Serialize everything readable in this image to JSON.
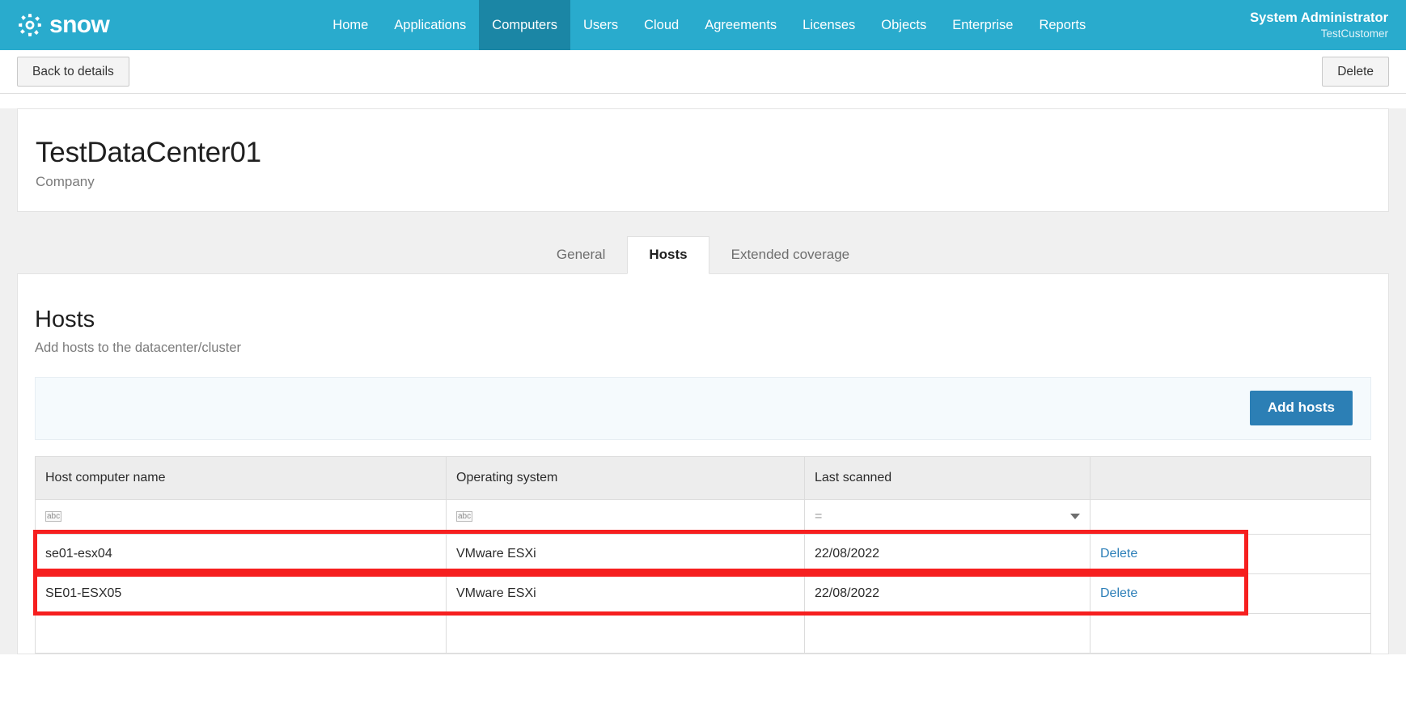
{
  "nav": {
    "brand": "snow",
    "brand_icon": "gear-icon",
    "items": [
      {
        "label": "Home",
        "active": false
      },
      {
        "label": "Applications",
        "active": false
      },
      {
        "label": "Computers",
        "active": true
      },
      {
        "label": "Users",
        "active": false
      },
      {
        "label": "Cloud",
        "active": false
      },
      {
        "label": "Agreements",
        "active": false
      },
      {
        "label": "Licenses",
        "active": false
      },
      {
        "label": "Objects",
        "active": false
      },
      {
        "label": "Enterprise",
        "active": false
      },
      {
        "label": "Reports",
        "active": false
      }
    ],
    "user_name": "System Administrator",
    "user_org": "TestCustomer"
  },
  "toolbar": {
    "back_label": "Back to details",
    "delete_label": "Delete"
  },
  "entity": {
    "title": "TestDataCenter01",
    "subtitle": "Company"
  },
  "tabs": [
    {
      "label": "General",
      "active": false
    },
    {
      "label": "Hosts",
      "active": true
    },
    {
      "label": "Extended coverage",
      "active": false
    }
  ],
  "section": {
    "title": "Hosts",
    "subtitle": "Add hosts to the datacenter/cluster",
    "add_hosts_label": "Add hosts"
  },
  "table": {
    "columns": [
      "Host computer name",
      "Operating system",
      "Last scanned",
      ""
    ],
    "filter": {
      "host_icon": "abc-filter-icon",
      "os_icon": "abc-filter-icon",
      "date_operator": "=",
      "date_caret": "chevron-down-icon"
    },
    "rows": [
      {
        "host": "se01-esx04",
        "os": "VMware ESXi",
        "last_scanned": "22/08/2022",
        "action": "Delete",
        "highlighted": true
      },
      {
        "host": "SE01-ESX05",
        "os": "VMware ESXi",
        "last_scanned": "22/08/2022",
        "action": "Delete",
        "highlighted": true
      }
    ]
  },
  "colors": {
    "brand_bar": "#29ABCD",
    "nav_active": "#1B86A5",
    "primary_button": "#2C7FB5",
    "link": "#2d7fb8",
    "annotation": "#f61f1f"
  }
}
